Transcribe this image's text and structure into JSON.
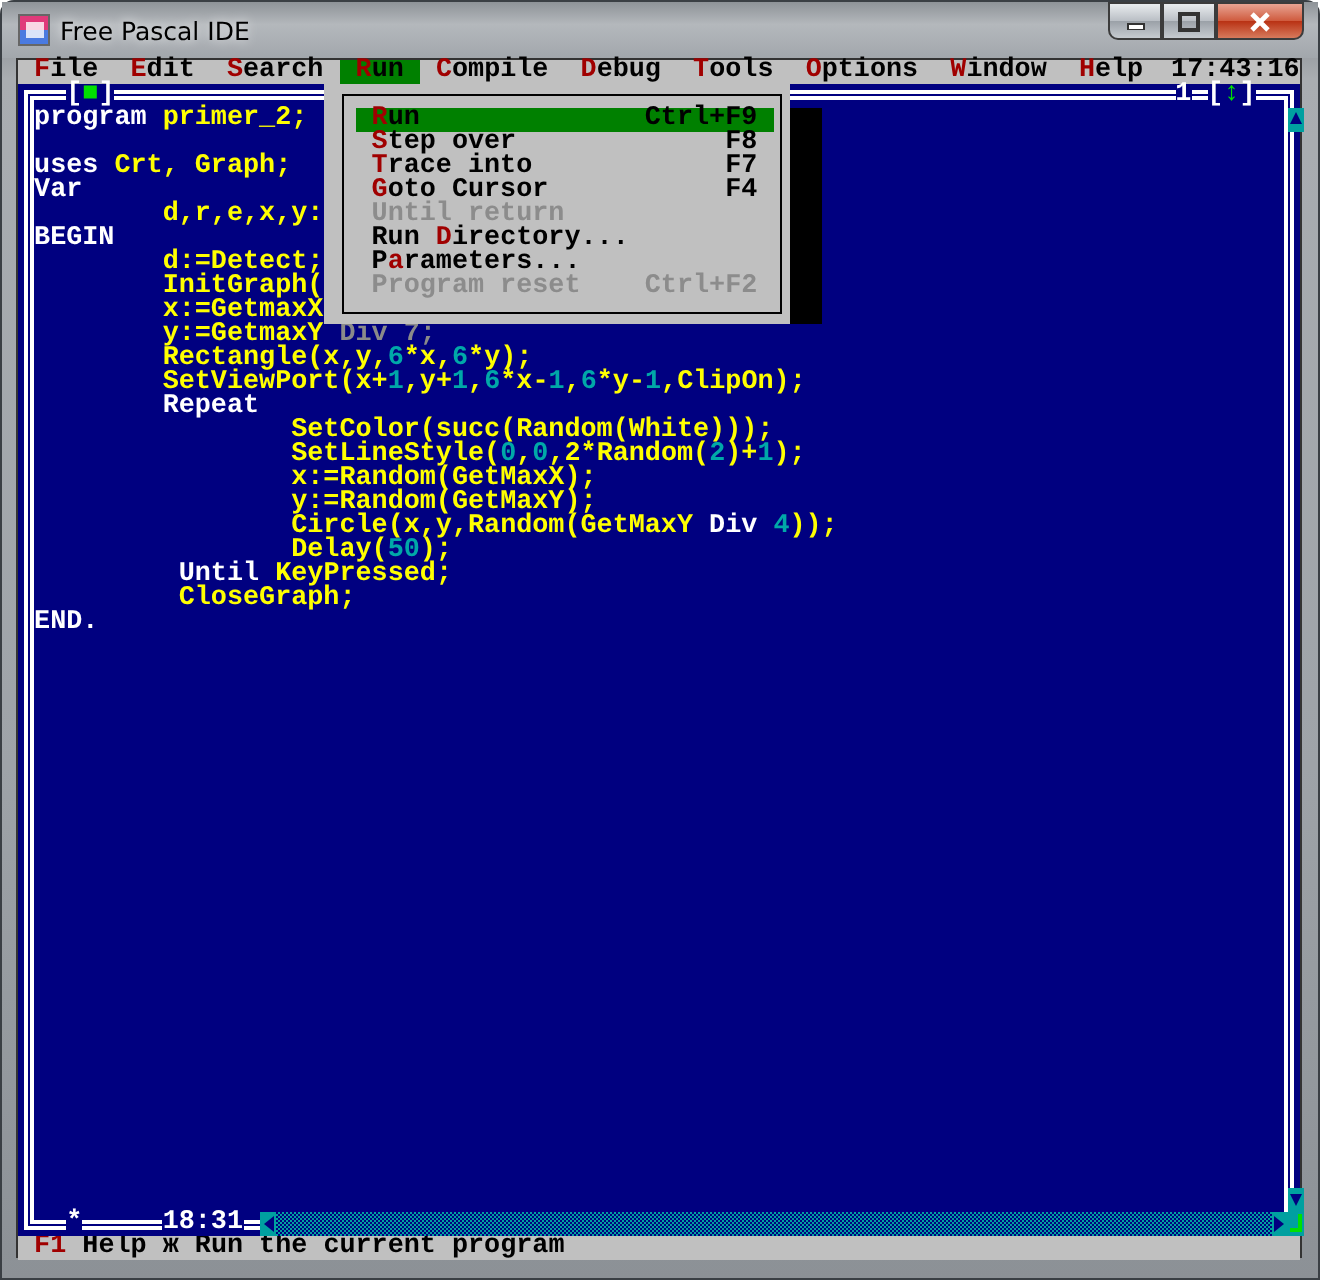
{
  "window": {
    "title": "Free Pascal IDE"
  },
  "menu_bar": {
    "items": [
      {
        "key": "F",
        "post": "ile",
        "selected": false
      },
      {
        "key": "E",
        "post": "dit",
        "selected": false
      },
      {
        "key": "S",
        "post": "earch",
        "selected": false
      },
      {
        "key": "R",
        "post": "un",
        "selected": true
      },
      {
        "key": "C",
        "post": "ompile",
        "selected": false
      },
      {
        "key": "D",
        "post": "ebug",
        "selected": false
      },
      {
        "key": "T",
        "post": "ools",
        "selected": false
      },
      {
        "key": "O",
        "post": "ptions",
        "selected": false
      },
      {
        "key": "W",
        "post": "indow",
        "selected": false
      },
      {
        "key": "H",
        "post": "elp",
        "selected": false
      }
    ],
    "clock": "17:43:16"
  },
  "run_menu": {
    "items": [
      {
        "key": "R",
        "post": "un",
        "shortcut": "Ctrl+F9",
        "selected": true,
        "disabled": false
      },
      {
        "key": "S",
        "post": "tep over",
        "shortcut": "F8",
        "selected": false,
        "disabled": false
      },
      {
        "key": "T",
        "post": "race into",
        "shortcut": "F7",
        "selected": false,
        "disabled": false
      },
      {
        "key": "G",
        "post": "oto Cursor",
        "shortcut": "F4",
        "selected": false,
        "disabled": false
      },
      {
        "key": "U",
        "post": "ntil return",
        "selected": false,
        "disabled": true
      },
      {
        "pre": "Run ",
        "key": "D",
        "post": "irectory...",
        "selected": false,
        "disabled": false
      },
      {
        "pre": "P",
        "key": "a",
        "post": "rameters...",
        "selected": false,
        "disabled": false
      },
      {
        "key": "P",
        "post": "rogram reset",
        "shortcut": "Ctrl+F2",
        "selected": false,
        "disabled": true
      }
    ]
  },
  "editor": {
    "close_button": "[■]",
    "window_number": "1",
    "zoom_button": "[↕]",
    "modified_mark": "*",
    "cursor_position": "18:31",
    "lines": [
      {
        "segments": [
          {
            "kind": "keyword",
            "text": "program"
          },
          {
            "kind": "identifier",
            "text": " primer_2;"
          }
        ]
      },
      {
        "kind": "blank"
      },
      {
        "segments": [
          {
            "kind": "keyword",
            "text": "uses"
          },
          {
            "kind": "identifier",
            "text": " Crt, Graph;"
          }
        ]
      },
      {
        "segments": [
          {
            "kind": "keyword",
            "text": "Var"
          }
        ]
      },
      {
        "segments": [
          {
            "kind": "identifier",
            "text": "        d,r,e,x,y:"
          }
        ]
      },
      {
        "segments": [
          {
            "kind": "keyword",
            "text": "BEGIN"
          }
        ]
      },
      {
        "segments": [
          {
            "kind": "identifier",
            "text": "        d:=Detect;"
          }
        ]
      },
      {
        "segments": [
          {
            "kind": "identifier",
            "text": "        InitGraph("
          }
        ]
      },
      {
        "segments": [
          {
            "kind": "identifier",
            "text": "        x:=GetmaxX"
          }
        ]
      },
      {
        "segments": [
          {
            "kind": "identifier",
            "text": "        y:=GetmaxY"
          },
          {
            "kind": "dimmed",
            "text": " Div 7;"
          }
        ]
      },
      {
        "segments": [
          {
            "kind": "identifier",
            "text": "        Rectangle(x,y,"
          },
          {
            "kind": "number",
            "text": "6"
          },
          {
            "kind": "identifier",
            "text": "*x,"
          },
          {
            "kind": "number",
            "text": "6"
          },
          {
            "kind": "identifier",
            "text": "*y);"
          }
        ]
      },
      {
        "segments": [
          {
            "kind": "identifier",
            "text": "        SetViewPort(x+"
          },
          {
            "kind": "number",
            "text": "1"
          },
          {
            "kind": "identifier",
            "text": ",y+"
          },
          {
            "kind": "number",
            "text": "1"
          },
          {
            "kind": "identifier",
            "text": ","
          },
          {
            "kind": "number",
            "text": "6"
          },
          {
            "kind": "identifier",
            "text": "*x-"
          },
          {
            "kind": "number",
            "text": "1"
          },
          {
            "kind": "identifier",
            "text": ","
          },
          {
            "kind": "number",
            "text": "6"
          },
          {
            "kind": "identifier",
            "text": "*y-"
          },
          {
            "kind": "number",
            "text": "1"
          },
          {
            "kind": "identifier",
            "text": ",ClipOn);"
          }
        ]
      },
      {
        "segments": [
          {
            "kind": "keyword",
            "text": "        Repeat"
          }
        ]
      },
      {
        "segments": [
          {
            "kind": "identifier",
            "text": "                SetColor(succ(Random(White)));"
          }
        ]
      },
      {
        "segments": [
          {
            "kind": "identifier",
            "text": "                SetLineStyle("
          },
          {
            "kind": "number",
            "text": "0"
          },
          {
            "kind": "identifier",
            "text": ","
          },
          {
            "kind": "number",
            "text": "0"
          },
          {
            "kind": "identifier",
            "text": ",2*Random("
          },
          {
            "kind": "number",
            "text": "2"
          },
          {
            "kind": "identifier",
            "text": ")+"
          },
          {
            "kind": "number",
            "text": "1"
          },
          {
            "kind": "identifier",
            "text": ");"
          }
        ]
      },
      {
        "segments": [
          {
            "kind": "identifier",
            "text": "                x:=Random(GetMaxX);"
          }
        ]
      },
      {
        "segments": [
          {
            "kind": "identifier",
            "text": "                y:=Random(GetMaxY);"
          }
        ]
      },
      {
        "segments": [
          {
            "kind": "identifier",
            "text": "                Circle(x,y,Random(GetMaxY "
          },
          {
            "kind": "keyword",
            "text": "Div"
          },
          {
            "kind": "number",
            "text": " 4"
          },
          {
            "kind": "identifier",
            "text": "));"
          }
        ]
      },
      {
        "segments": [
          {
            "kind": "identifier",
            "text": "                Delay("
          },
          {
            "kind": "number",
            "text": "50"
          },
          {
            "kind": "identifier",
            "text": ");"
          }
        ]
      },
      {
        "segments": [
          {
            "kind": "keyword",
            "text": "         Until"
          },
          {
            "kind": "identifier",
            "text": " KeyPressed;"
          }
        ]
      },
      {
        "segments": [
          {
            "kind": "identifier",
            "text": "         CloseGraph;"
          }
        ]
      },
      {
        "segments": [
          {
            "kind": "keyword",
            "text": "END."
          }
        ]
      }
    ]
  },
  "status_bar": {
    "key": "F1",
    "text": "Help ж Run the current program"
  }
}
